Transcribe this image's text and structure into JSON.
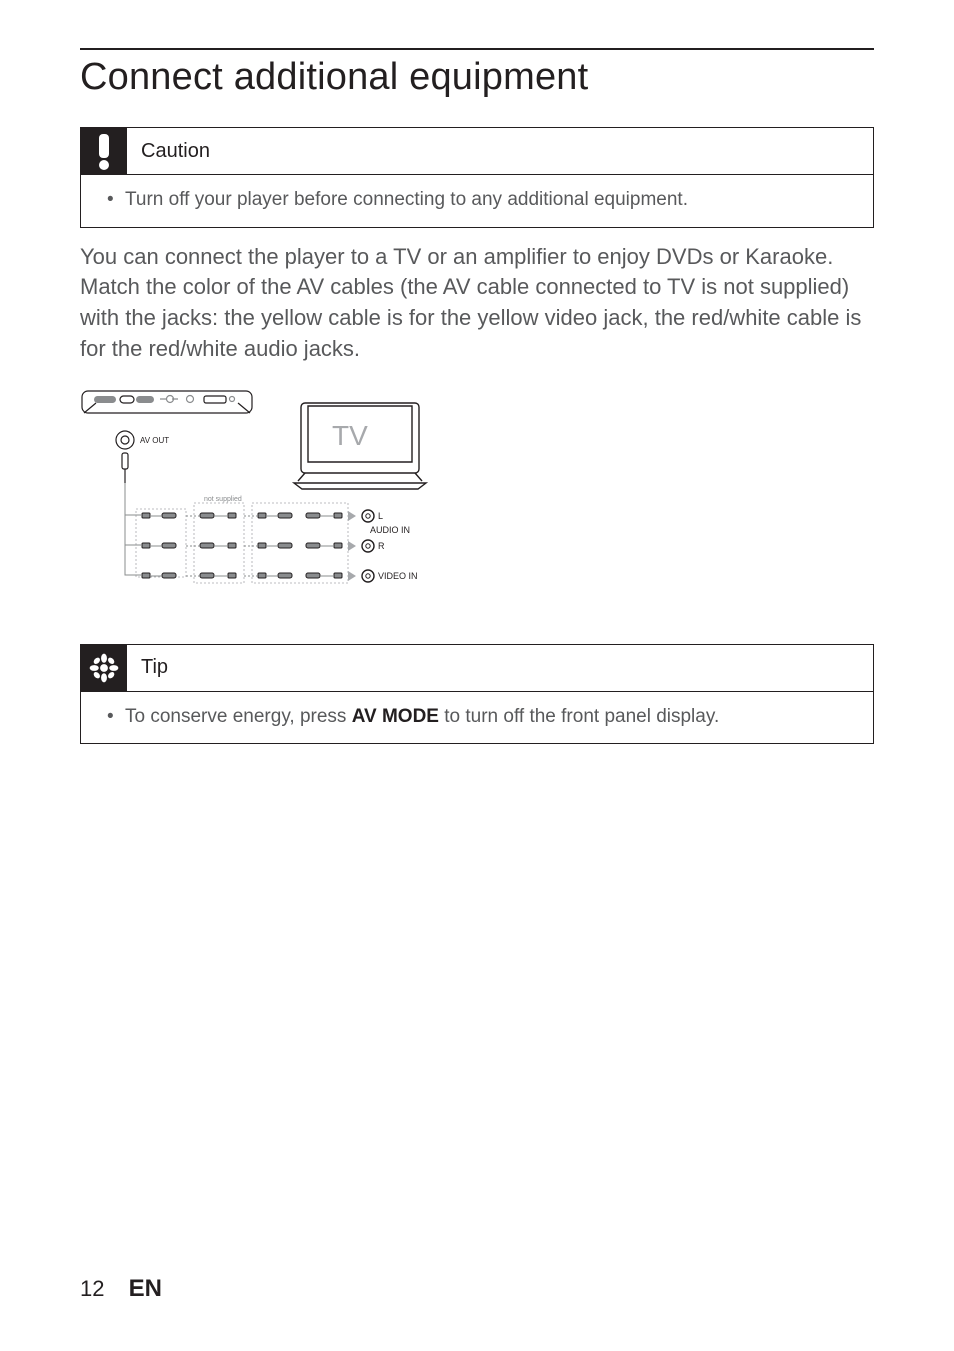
{
  "heading": "Connect additional equipment",
  "caution": {
    "title": "Caution",
    "item": "Turn off your player before connecting to any additional equipment."
  },
  "body": {
    "line1": "You can connect the player to a TV or an amplifier to enjoy DVDs or Karaoke.",
    "line2": "Match the color of the AV cables (the AV cable connected to TV is not supplied) with the jacks: the yellow cable is for the yellow video jack, the red/white cable is for the red/white audio jacks."
  },
  "diagram": {
    "av_out": "AV OUT",
    "tv": "TV",
    "not_supplied": "not supplied",
    "l": "L",
    "audio_in": "AUDIO IN",
    "r": "R",
    "video_in": "VIDEO IN"
  },
  "tip": {
    "title": "Tip",
    "item_pre": "To conserve energy, press ",
    "item_bold": "AV MODE",
    "item_post": " to turn off the front panel display."
  },
  "footer": {
    "page": "12",
    "lang": "EN"
  }
}
